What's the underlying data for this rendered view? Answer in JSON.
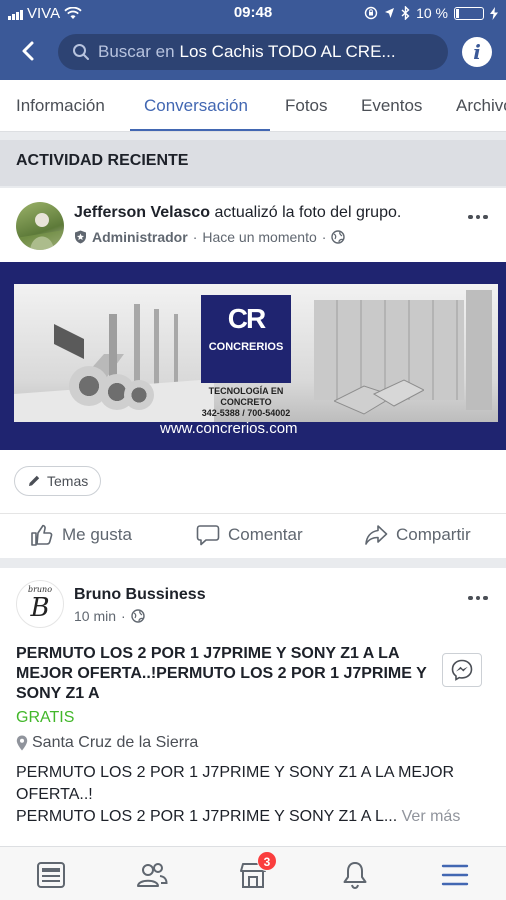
{
  "status_bar": {
    "carrier": "VIVA",
    "time": "09:48",
    "battery": "10 %",
    "battery_level": 0.1
  },
  "header": {
    "search_placeholder": "Buscar en",
    "group_name": "Los Cachis TODO AL CRE...",
    "back_icon": "chevron-left-icon",
    "info_icon": "info-icon",
    "info_glyph": "i"
  },
  "tabs": [
    {
      "label": "Información",
      "active": false
    },
    {
      "label": "Conversación",
      "active": true
    },
    {
      "label": "Fotos",
      "active": false
    },
    {
      "label": "Eventos",
      "active": false
    },
    {
      "label": "Archivos",
      "active": false
    }
  ],
  "section_title": "ACTIVIDAD RECIENTE",
  "post1": {
    "author": "Jefferson Velasco",
    "action": "actualizó la foto del grupo.",
    "role": "Administrador",
    "time": "Hace un momento",
    "image": {
      "brand": "CONCRERIOS",
      "mark": "CR",
      "tagline": "TECNOLOGÍA EN CONCRETO",
      "phones": "342-5388 / 700-54002",
      "url": "www.concrerios.com"
    },
    "chip_label": "Temas",
    "actions": {
      "like": "Me gusta",
      "comment": "Comentar",
      "share": "Compartir"
    }
  },
  "post2": {
    "author": "Bruno Bussiness",
    "avatar_script": "bruno",
    "avatar_initial": "B",
    "time": "10 min",
    "title": "PERMUTO LOS 2 POR 1  J7PRIME Y SONY Z1 A LA MEJOR OFERTA..!PERMUTO LOS 2 POR 1  J7PRIME Y SONY Z1 A",
    "price": "GRATIS",
    "location": "Santa Cruz de la Sierra",
    "description_line1": "PERMUTO LOS 2 POR 1  J7PRIME Y SONY Z1 A LA MEJOR OFERTA..!",
    "description_line2": "PERMUTO LOS 2 POR 1  J7PRIME Y SONY Z1 A L...",
    "see_more": "Ver más"
  },
  "bottom_nav": {
    "items": [
      "news-feed-icon",
      "friends-icon",
      "marketplace-icon",
      "notifications-icon",
      "menu-icon"
    ],
    "marketplace_badge": "3",
    "active": "menu-icon"
  },
  "colors": {
    "brand_blue": "#3b5998",
    "accent": "#4267b2",
    "price_green": "#42b72a",
    "badge_red": "#fa3e3e"
  }
}
